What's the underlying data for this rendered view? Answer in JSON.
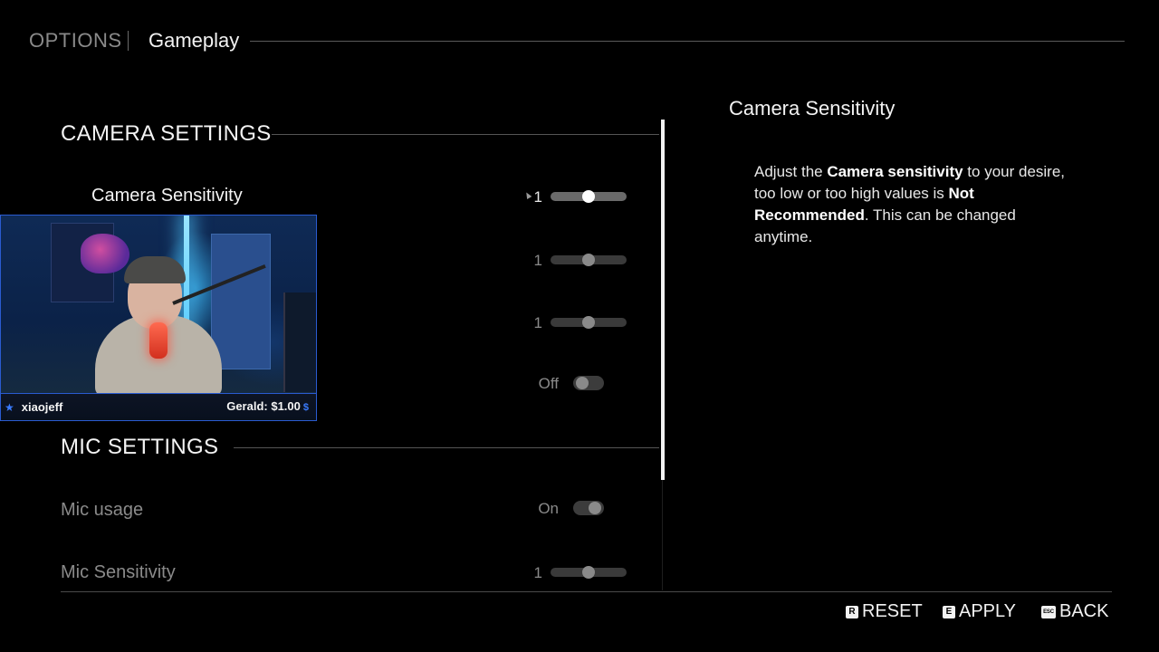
{
  "header": {
    "section": "OPTIONS",
    "page": "Gameplay"
  },
  "camera_settings": {
    "title": "CAMERA SETTINGS",
    "rows": [
      {
        "label": "Camera Sensitivity",
        "value": "1",
        "control": "slider",
        "level": 0.5,
        "active": true
      },
      {
        "label": "",
        "value": "1",
        "control": "slider",
        "level": 0.5
      },
      {
        "label": "",
        "value": "1",
        "control": "slider",
        "level": 0.5
      },
      {
        "label": "",
        "value": "Off",
        "control": "toggle",
        "state": "off"
      }
    ]
  },
  "mic_settings": {
    "title": "MIC SETTINGS",
    "rows": [
      {
        "label": "Mic usage",
        "value": "On",
        "control": "toggle",
        "state": "on"
      },
      {
        "label": "Mic Sensitivity",
        "value": "1",
        "control": "slider",
        "level": 0.5
      }
    ]
  },
  "info_panel": {
    "title": "Camera Sensitivity",
    "text_1": "Adjust the ",
    "bold_1": "Camera sensitivity",
    "text_2": " to your desire, too low or too high values is ",
    "bold_2": "Not Recommended",
    "text_3": ". This can be changed anytime."
  },
  "footer": {
    "reset": {
      "key": "R",
      "label": "RESET"
    },
    "apply": {
      "key": "E",
      "label": "APPLY"
    },
    "back": {
      "key": "ESC",
      "label": "BACK"
    }
  },
  "webcam": {
    "name": "xiaojeff",
    "donation": "Gerald: $1.00",
    "currency_icon": "$"
  },
  "colors": {
    "accent": "#2a5bd0",
    "text": "#f4f4f4",
    "dim": "#8a8a8a"
  }
}
